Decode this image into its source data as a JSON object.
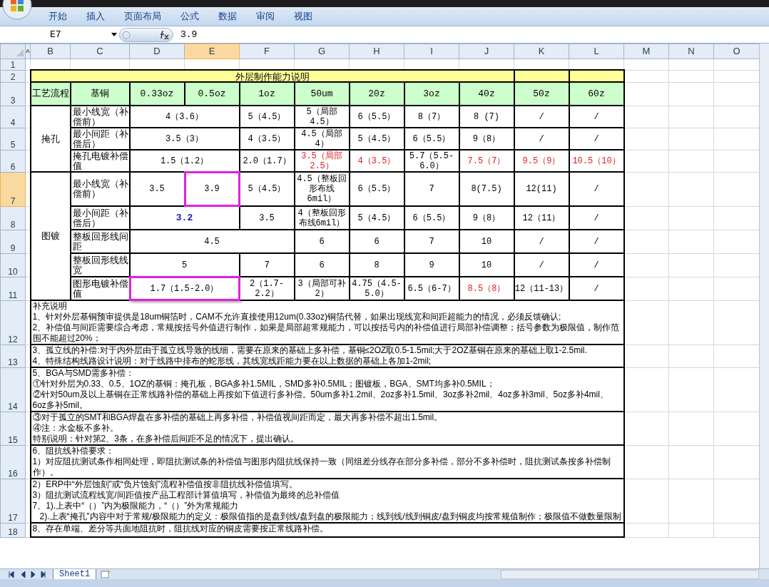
{
  "ribbon": {
    "tabs": [
      "开始",
      "插入",
      "页面布局",
      "公式",
      "数据",
      "审阅",
      "视图"
    ]
  },
  "formula_bar": {
    "name_box": "E7",
    "formula": "3.9"
  },
  "column_headers": [
    {
      "label": "A",
      "selected": false
    },
    {
      "label": "B",
      "selected": false
    },
    {
      "label": "C",
      "selected": false
    },
    {
      "label": "D",
      "selected": false
    },
    {
      "label": "E",
      "selected": true
    },
    {
      "label": "F",
      "selected": false
    },
    {
      "label": "G",
      "selected": false
    },
    {
      "label": "H",
      "selected": false
    },
    {
      "label": "I",
      "selected": false
    },
    {
      "label": "J",
      "selected": false
    },
    {
      "label": "K",
      "selected": false
    },
    {
      "label": "L",
      "selected": false
    },
    {
      "label": "M",
      "selected": false
    },
    {
      "label": "N",
      "selected": false
    },
    {
      "label": "O",
      "selected": false
    }
  ],
  "rows": [
    {
      "header": "1",
      "selected": false,
      "cells": []
    },
    {
      "header": "2",
      "selected": false,
      "cells": [
        {
          "kind": "title",
          "text": "外层制作能力说明"
        },
        {
          "kind": "title"
        },
        {
          "kind": "title"
        }
      ]
    },
    {
      "header": "3",
      "selected": false,
      "cells": [
        {
          "kind": "header",
          "text": "工艺流程"
        },
        {
          "kind": "header",
          "text": "基铜"
        },
        {
          "kind": "header",
          "text": "0.33oz"
        },
        {
          "kind": "header",
          "text": "0.5oz"
        },
        {
          "kind": "header",
          "text": "1oz"
        },
        {
          "kind": "header",
          "text": "50um"
        },
        {
          "kind": "header",
          "text": "20z"
        },
        {
          "kind": "header",
          "text": "3oz"
        },
        {
          "kind": "header",
          "text": "40z"
        },
        {
          "kind": "header",
          "text": "50z"
        },
        {
          "kind": "header",
          "text": "60z"
        }
      ]
    },
    {
      "header": "4",
      "selected": false,
      "cells": [
        {
          "kind": "group",
          "text": "掩孔"
        },
        {
          "kind": "label",
          "text": "最小线宽（补偿前）"
        },
        {
          "kind": "value",
          "text": "4（3.6）"
        },
        {
          "kind": "value",
          "text": "5（4.5）"
        },
        {
          "kind": "value",
          "text": "5（局部4.5）"
        },
        {
          "kind": "value",
          "text": "6（5.5）"
        },
        {
          "kind": "value",
          "text": "8（7）"
        },
        {
          "kind": "value",
          "text": "8 (7)"
        },
        {
          "kind": "value",
          "text": "/"
        },
        {
          "kind": "value",
          "text": "/"
        }
      ]
    },
    {
      "header": "5",
      "selected": false,
      "cells": [
        {
          "kind": "label",
          "text": "最小间距（补偿后）"
        },
        {
          "kind": "value",
          "text": "3.5（3）"
        },
        {
          "kind": "value",
          "text": "4（3.5）"
        },
        {
          "kind": "value",
          "text": "4.5（局部4）"
        },
        {
          "kind": "value",
          "text": "5（4.5）"
        },
        {
          "kind": "value",
          "text": "6（5.5）"
        },
        {
          "kind": "value",
          "text": "9（8）"
        },
        {
          "kind": "value",
          "text": "/"
        },
        {
          "kind": "value",
          "text": "/"
        }
      ]
    },
    {
      "header": "6",
      "selected": false,
      "cells": [
        {
          "kind": "label",
          "text": "掩孔电镀补偿值"
        },
        {
          "kind": "value",
          "text": "1.5（1.2）"
        },
        {
          "kind": "value",
          "text": "2.0（1.7）"
        },
        {
          "kind": "value",
          "text": "3.5（局部2.5）",
          "color": "#e02020"
        },
        {
          "kind": "value",
          "text": "4（3.5）",
          "color": "#e02020"
        },
        {
          "kind": "value",
          "text": "5.7（5.5-6.0）"
        },
        {
          "kind": "value",
          "text": "7.5（7）",
          "color": "#e02020"
        },
        {
          "kind": "value",
          "text": "9.5（9）",
          "color": "#e02020"
        },
        {
          "kind": "value",
          "text": "10.5（10）",
          "color": "#e02020"
        }
      ]
    },
    {
      "header": "7",
      "selected": true,
      "cells": [
        {
          "kind": "group",
          "text": "图镀"
        },
        {
          "kind": "label",
          "text": "最小线宽（补偿前）"
        },
        {
          "kind": "value",
          "text": "3.5"
        },
        {
          "kind": "value",
          "text": "3.9",
          "highlighted": true
        },
        {
          "kind": "value",
          "text": "5（4.5）"
        },
        {
          "kind": "value",
          "text": "4.5（整板回形布线6mil）"
        },
        {
          "kind": "value",
          "text": "6（5.5）"
        },
        {
          "kind": "value",
          "text": "7"
        },
        {
          "kind": "value",
          "text": "8(7.5)"
        },
        {
          "kind": "value",
          "text": "12(11)"
        },
        {
          "kind": "value",
          "text": "/"
        }
      ]
    },
    {
      "header": "8",
      "selected": false,
      "cells": [
        {
          "kind": "label",
          "text": "最小间距（补偿后）"
        },
        {
          "kind": "value",
          "text": "3.2",
          "bold": true,
          "color": "#1a1aa0"
        },
        {
          "kind": "value",
          "text": "3.5"
        },
        {
          "kind": "value",
          "text": "4（整板回形布线6mil）"
        },
        {
          "kind": "value",
          "text": "5（4.5）"
        },
        {
          "kind": "value",
          "text": "6（5.5）"
        },
        {
          "kind": "value",
          "text": "9（8）"
        },
        {
          "kind": "value",
          "text": "12（11）"
        },
        {
          "kind": "value",
          "text": "/"
        }
      ]
    },
    {
      "header": "9",
      "selected": false,
      "cells": [
        {
          "kind": "label",
          "text": "整板回形线间距"
        },
        {
          "kind": "value",
          "text": "4.5"
        },
        {
          "kind": "value",
          "text": "6"
        },
        {
          "kind": "value",
          "text": "6"
        },
        {
          "kind": "value",
          "text": "7"
        },
        {
          "kind": "value",
          "text": "10"
        },
        {
          "kind": "value",
          "text": "/"
        },
        {
          "kind": "value",
          "text": "/"
        }
      ]
    },
    {
      "header": "10",
      "selected": false,
      "cells": [
        {
          "kind": "label",
          "text": "整板回形线线宽"
        },
        {
          "kind": "value",
          "text": "5"
        },
        {
          "kind": "value",
          "text": "7"
        },
        {
          "kind": "value",
          "text": "6"
        },
        {
          "kind": "value",
          "text": "8"
        },
        {
          "kind": "value",
          "text": "9"
        },
        {
          "kind": "value",
          "text": "10"
        },
        {
          "kind": "value",
          "text": "/"
        },
        {
          "kind": "value",
          "text": "/"
        }
      ]
    },
    {
      "header": "11",
      "selected": false,
      "cells": [
        {
          "kind": "label",
          "text": "图形电镀补偿值"
        },
        {
          "kind": "value",
          "text": "1.7（1.5-2.0）",
          "highlighted": true
        },
        {
          "kind": "value",
          "text": "2（1.7-2.2）"
        },
        {
          "kind": "value",
          "text": "3（局部可补2）"
        },
        {
          "kind": "value",
          "text": "4.75（4.5-5.0）"
        },
        {
          "kind": "value",
          "text": "6.5（6-7）"
        },
        {
          "kind": "value",
          "text": "8.5（8）",
          "color": "#e02020"
        },
        {
          "kind": "value",
          "text": "12（11-13）"
        },
        {
          "kind": "value",
          "text": "/"
        }
      ]
    },
    {
      "header": "12",
      "selected": false,
      "cells": [
        {
          "kind": "note",
          "lines": [
            "补充说明",
            "1、针对外层基铜预审提供是18um铜箔时，CAM不允许直接使用12um(0.33oz)铜箔代替，如果出现线宽和间距超能力的情况，必须反馈确认;",
            "2、补偿值与间距需要综合考虑，常规按括号外值进行制作，如果是局部超常规能力，可以按括号内的补偿值进行局部补偿调整；括号参数为极限值，制作范围不能超过20%；"
          ]
        }
      ]
    },
    {
      "header": "13",
      "selected": false,
      "cells": [
        {
          "kind": "note",
          "lines": [
            "3、孤立线的补偿:对于内外层由于孤立线导致的线细，需要在原来的基础上多补偿，基铜≤2OZ取0.5-1.5mil;大于2OZ基铜在原来的基础上取1-2.5mil.",
            "4、特殊结构线路设计说明：对于线路中排布的蛇形线，其线宽线距能力要在以上数据的基础上各加1-2mil;"
          ]
        }
      ]
    },
    {
      "header": "14",
      "selected": false,
      "cells": [
        {
          "kind": "note",
          "lines": [
            "5、BGA与SMD需多补偿：",
            "①针对外层为0.33、0.5、1OZ的基铜：掩孔板，BGA多补1.5MIL，SMD多补0.5MIL；图镀板，BGA、SMT均多补0.5MIL；",
            "②针对50um及以上基铜在正常线路补偿的基础上再按如下值进行多补偿。50um多补1.2mil、2oz多补1.5mil、3oz多补2mil、4oz多补3mil、5oz多补4mil、6oz多补5mil。"
          ]
        }
      ]
    },
    {
      "header": "15",
      "selected": false,
      "cells": [
        {
          "kind": "note",
          "lines": [
            "③对于孤立的SMT和BGA焊盘在多补偿的基础上再多补偿，补偿值视间距而定，最大再多补偿不超出1.5mil。",
            "④注：水金板不多补。",
            "特别说明：针对第2、3条，在多补偿后间距不足的情况下，提出确认。"
          ]
        }
      ]
    },
    {
      "header": "16",
      "selected": false,
      "cells": [
        {
          "kind": "note",
          "lines": [
            "6、阻抗线补偿要求：",
            "1）对应阻抗测试条作相同处理，即阻抗测试条的补偿值与图形内阻抗线保持一致（同组差分线存在部分多补偿，部分不多补偿时，阻抗测试条按多补偿制作）。"
          ]
        }
      ]
    },
    {
      "header": "17",
      "selected": false,
      "cells": [
        {
          "kind": "note",
          "lines": [
            "2）ERP中“外层蚀刻”或“负片蚀刻”流程补偿值按非阻抗线补偿值填写。",
            "3）阻抗测试流程线宽/间距值按产品工程部计算值填写，补偿值为最终的总补偿值",
            "7、1).上表中“（）”内为极限能力，“（）”外为常规能力",
            "   2).上表“掩孔”内容中对于常规/极限能力的定义：极限值指的是盘到线/盘到盘的极限能力；线到线/线到铜皮/盘到铜皮均按常规值制作；极限值不做数量限制"
          ]
        }
      ]
    },
    {
      "header": "18",
      "selected": false,
      "cells": [
        {
          "kind": "note",
          "lines": [
            "8、存在单端、差分等共面地阻抗时，阻抗线对应的铜皮需要按正常线路补偿。"
          ]
        }
      ]
    }
  ],
  "sheet_tabs": [
    {
      "label": "Sheet1",
      "selected": true
    }
  ]
}
